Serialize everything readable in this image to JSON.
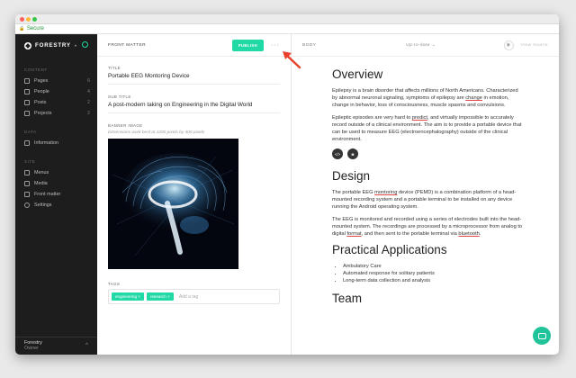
{
  "browser": {
    "secure_label": "Secure"
  },
  "sidebar": {
    "brand": "FORESTRY",
    "content_heading": "CONTENT",
    "items": [
      {
        "label": "Pages",
        "count": "6",
        "icon": "pages-icon"
      },
      {
        "label": "People",
        "count": "4",
        "icon": "people-icon"
      },
      {
        "label": "Posts",
        "count": "2",
        "icon": "posts-icon"
      },
      {
        "label": "Projects",
        "count": "2",
        "icon": "projects-icon"
      }
    ],
    "data_heading": "DATA",
    "data_items": [
      {
        "label": "Information",
        "icon": "table-icon"
      }
    ],
    "site_heading": "SITE",
    "site_items": [
      {
        "label": "Menus",
        "icon": "menu-icon"
      },
      {
        "label": "Media",
        "icon": "media-icon"
      },
      {
        "label": "Front matter",
        "icon": "front-matter-icon"
      },
      {
        "label": "Settings",
        "icon": "gear-icon"
      }
    ],
    "footer": {
      "name": "Forestry",
      "role": "Owner"
    }
  },
  "editor": {
    "header": "FRONT MATTER",
    "publish_label": "PUBLISH",
    "more_label": "···",
    "title_label": "TITLE",
    "title_value": "Portable EEG Montoring Device",
    "subtitle_label": "SUB TITLE",
    "subtitle_value": "A post-modern taking on Engineering in the Digital World",
    "banner_label": "BANNER IMAGE",
    "banner_hint": "Dimensions work best at 1200 pixels by 400 pixels",
    "tags_label": "TAGS",
    "tags": [
      "engineering ×",
      "research ×"
    ],
    "add_tag_placeholder": "Add a tag"
  },
  "preview": {
    "header": "BODY",
    "status": "Up-to-date",
    "view_source": "View source",
    "overview_heading": "Overview",
    "overview_p1_a": "Epilepsy is a brain disorder that affects millions of North Americans. Characterized by abnormal neuronal signaling, symptoms of epilepsy are ",
    "overview_p1_u": "change",
    "overview_p1_b": " in emotion, change in behavior, loss of consciousness, muscle spasms and convulsions.",
    "overview_p2_a": "Epileptic episodes are very hard to ",
    "overview_p2_u": "predict",
    "overview_p2_b": ", and virtually impossible to accurately record outside of a clinical environment. The aim is to provide a portable device that can be used to measure EEG (electroencephalography) outside of the clinical environment.",
    "design_heading": "Design",
    "design_p1_a": "The portable EEG ",
    "design_p1_u": "montoring",
    "design_p1_b": " device (PEMD) is a combination platform of a head-mounted recording system and a portable terminal to be installed on any device running the Android operating system.",
    "design_p2_a": "The EEG is monitored and recorded using a series of electrodes built into the head-mounted system. The recordings are processed by a microprocessor from analog to digital ",
    "design_p2_u1": "format",
    "design_p2_b": ", and then sent to the portable terminal via ",
    "design_p2_u2": "bluetooth",
    "design_p2_c": ".",
    "apps_heading": "Practical Applications",
    "apps_items": [
      "Ambulatory Care",
      "Automated response for solitary patients",
      "Long-term data collection and analysis"
    ],
    "team_heading": "Team"
  },
  "colors": {
    "accent": "#21d9a4",
    "sidebar_bg": "#1d1d1d",
    "annotation_arrow": "#e8402a"
  }
}
